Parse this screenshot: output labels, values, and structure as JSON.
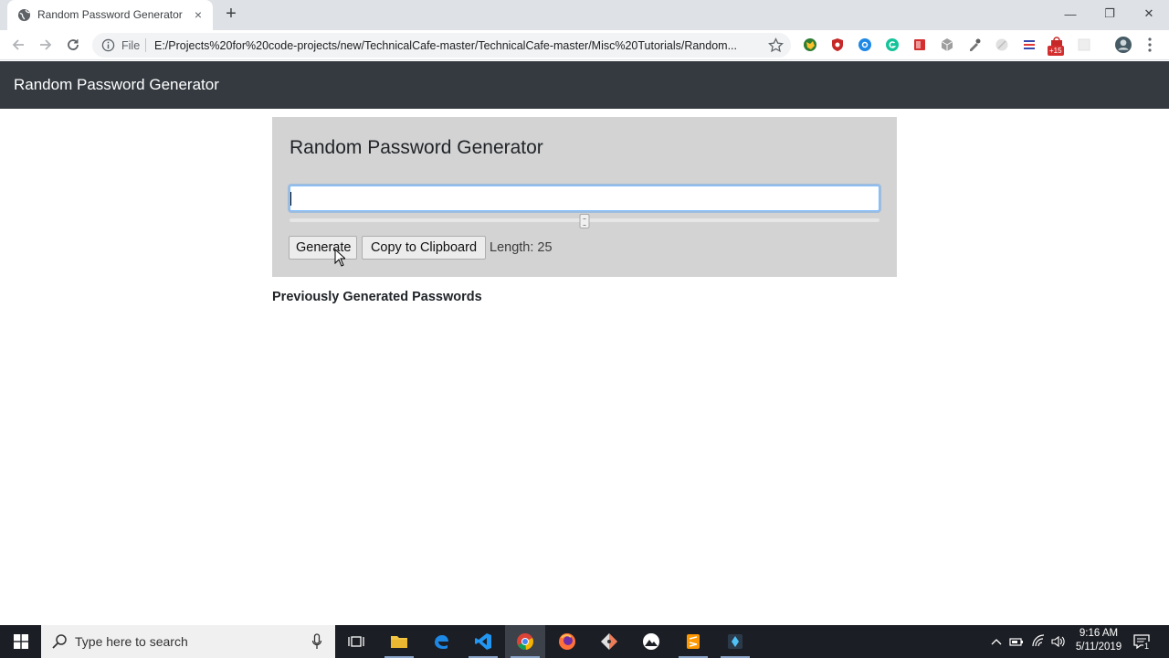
{
  "browser": {
    "tab_title": "Random Password Generator",
    "tab_close": "×",
    "new_tab": "+",
    "window_controls": {
      "minimize": "—",
      "restore": "❐",
      "close": "✕"
    },
    "omnibox": {
      "security_label": "File",
      "url": "E:/Projects%20for%20code-projects/new/TechnicalCafe-master/TechnicalCafe-master/Misc%20Tutorials/Random..."
    },
    "extension_badge": "+15"
  },
  "page": {
    "navbar_brand": "Random Password Generator",
    "card": {
      "title": "Random Password Generator",
      "password_value": "",
      "slider_value": 25,
      "generate_label": "Generate",
      "copy_label": "Copy to Clipboard",
      "length_text": "Length: 25"
    },
    "history_heading": "Previously Generated Passwords"
  },
  "taskbar": {
    "search_placeholder": "Type here to search",
    "clock_time": "9:16 AM",
    "clock_date": "5/11/2019",
    "notification_count": "1"
  },
  "colors": {
    "navbar": "#343a40",
    "card": "#d3d3d3",
    "focus_ring": "#80bdff",
    "taskbar": "#1b1e24"
  }
}
